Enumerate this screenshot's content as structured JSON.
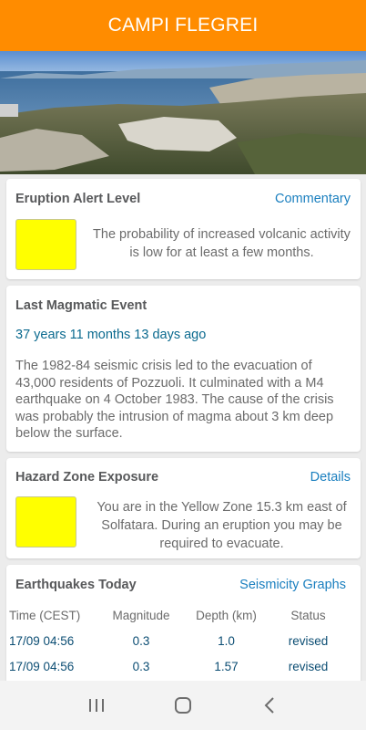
{
  "appbar": {
    "title": "CAMPI FLEGREI"
  },
  "alert": {
    "title": "Eruption Alert Level",
    "link": "Commentary",
    "color": "#ffff00",
    "text": "The probability of increased volcanic activity is low for at least a few months."
  },
  "magmatic": {
    "title": "Last Magmatic Event",
    "elapsed": "37 years 11 months 13 days ago",
    "description": "The 1982-84 seismic crisis led to the evacuation of 43,000 residents of Pozzuoli. It culminated with a M4 earthquake on 4 October 1983. The cause of the crisis was probably the intrusion of magma about 3 km deep below the surface."
  },
  "hazard": {
    "title": "Hazard Zone Exposure",
    "link": "Details",
    "color": "#ffff00",
    "text": "You are in the Yellow Zone 15.3 km east of Solfatara. During an eruption you may be required to evacuate."
  },
  "earthquakes": {
    "title": "Earthquakes Today",
    "link": "Seismicity Graphs",
    "columns": [
      "Time (CEST)",
      "Magnitude",
      "Depth (km)",
      "Status"
    ],
    "rows": [
      {
        "time": "17/09 04:56",
        "magnitude": "0.3",
        "depth": "1.0",
        "status": "revised"
      },
      {
        "time": "17/09 04:56",
        "magnitude": "0.3",
        "depth": "1.57",
        "status": "revised"
      }
    ]
  },
  "navbar": {
    "icons": [
      "recent-apps-icon",
      "home-icon",
      "back-icon"
    ]
  },
  "colors": {
    "accent": "#ff8c00",
    "link": "#1a7fbf",
    "value": "#0b4d73"
  }
}
